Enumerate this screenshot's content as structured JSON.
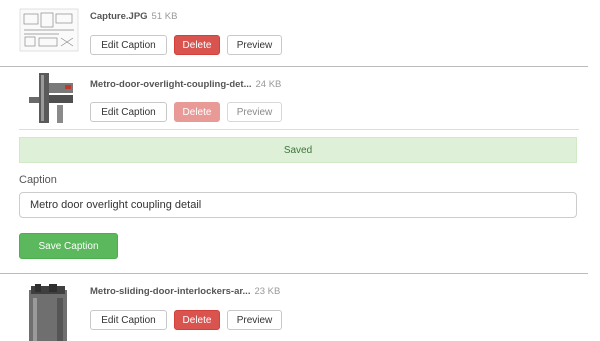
{
  "files": [
    {
      "name": "Capture.JPG",
      "size": "51 KB",
      "buttons": {
        "edit": "Edit Caption",
        "delete": "Delete",
        "preview": "Preview"
      }
    },
    {
      "name": "Metro-door-overlight-coupling-det...",
      "size": "24 KB",
      "buttons": {
        "edit": "Edit Caption",
        "delete": "Delete",
        "preview": "Preview"
      }
    },
    {
      "name": "Metro-sliding-door-interlockers-ar...",
      "size": "23 KB",
      "buttons": {
        "edit": "Edit Caption",
        "delete": "Delete",
        "preview": "Preview"
      }
    }
  ],
  "editor": {
    "saved_message": "Saved",
    "caption_label": "Caption",
    "caption_value": "Metro door overlight coupling detail",
    "save_label": "Save Caption"
  },
  "colors": {
    "danger": "#d9534f",
    "success": "#5cb85c",
    "saved_bg": "#dff0d8"
  },
  "icons": [
    "drawing-thumbnail",
    "door-profile-thumbnail",
    "sliding-door-thumbnail"
  ]
}
